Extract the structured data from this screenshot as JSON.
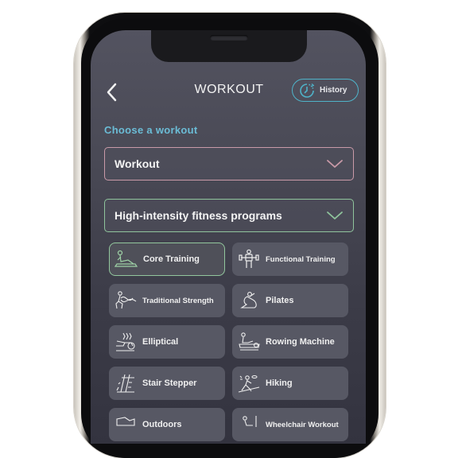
{
  "header": {
    "title": "WORKOUT",
    "back_icon": "chevron-left-icon",
    "history_button": {
      "label": "History",
      "icon": "history-clock-icon"
    }
  },
  "colors": {
    "accent_blue": "#4fb3c9",
    "label_blue": "#6bbcd6",
    "pink_border": "#c99aa8",
    "green_border": "#8fc49c"
  },
  "section_label": "Choose a workout",
  "selects": [
    {
      "value": "Workout",
      "icon": "chevron-down-icon"
    },
    {
      "value": "High-intensity fitness programs",
      "icon": "chevron-down-icon"
    }
  ],
  "workouts": [
    {
      "label": "Core Training",
      "icon": "core-training-icon",
      "selected": true
    },
    {
      "label": "Functional Training",
      "icon": "functional-training-icon",
      "selected": false
    },
    {
      "label": "Traditional Strength",
      "icon": "traditional-strength-icon",
      "selected": false
    },
    {
      "label": "Pilates",
      "icon": "pilates-icon",
      "selected": false
    },
    {
      "label": "Elliptical",
      "icon": "elliptical-icon",
      "selected": false
    },
    {
      "label": "Rowing Machine",
      "icon": "rowing-machine-icon",
      "selected": false
    },
    {
      "label": "Stair Stepper",
      "icon": "stair-stepper-icon",
      "selected": false
    },
    {
      "label": "Hiking",
      "icon": "hiking-icon",
      "selected": false
    },
    {
      "label": "Outdoors",
      "icon": "outdoor-icon",
      "selected": false
    },
    {
      "label": "Wheelchair Workout",
      "icon": "wheelchair-icon",
      "selected": false
    }
  ]
}
